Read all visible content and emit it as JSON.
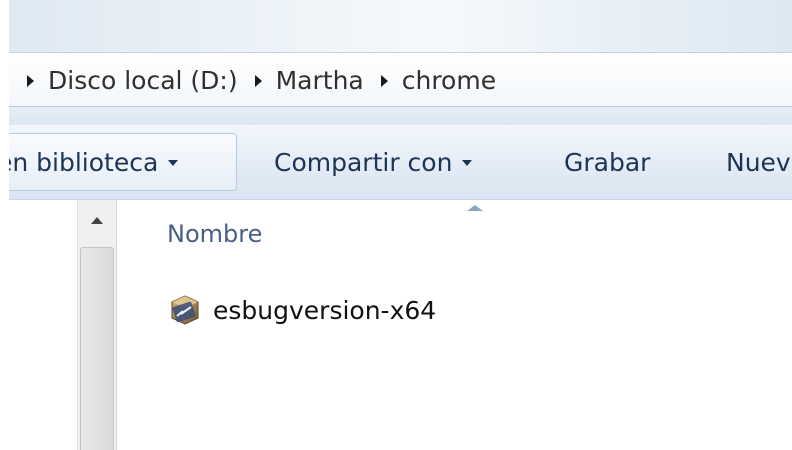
{
  "window": {
    "accent": "#1e3455"
  },
  "address_bar": {
    "crumbs": [
      "Disco local (D:)",
      "Martha",
      "chrome"
    ]
  },
  "toolbar": {
    "include_library_label": "en biblioteca",
    "share_label": "Compartir con",
    "burn_label": "Grabar",
    "new_folder_label": "Nuev"
  },
  "file_list": {
    "name_column_header": "Nombre",
    "sort_indicator": "ascending",
    "items": [
      {
        "name": "esbugversion-x64",
        "icon": "application-icon"
      }
    ]
  }
}
